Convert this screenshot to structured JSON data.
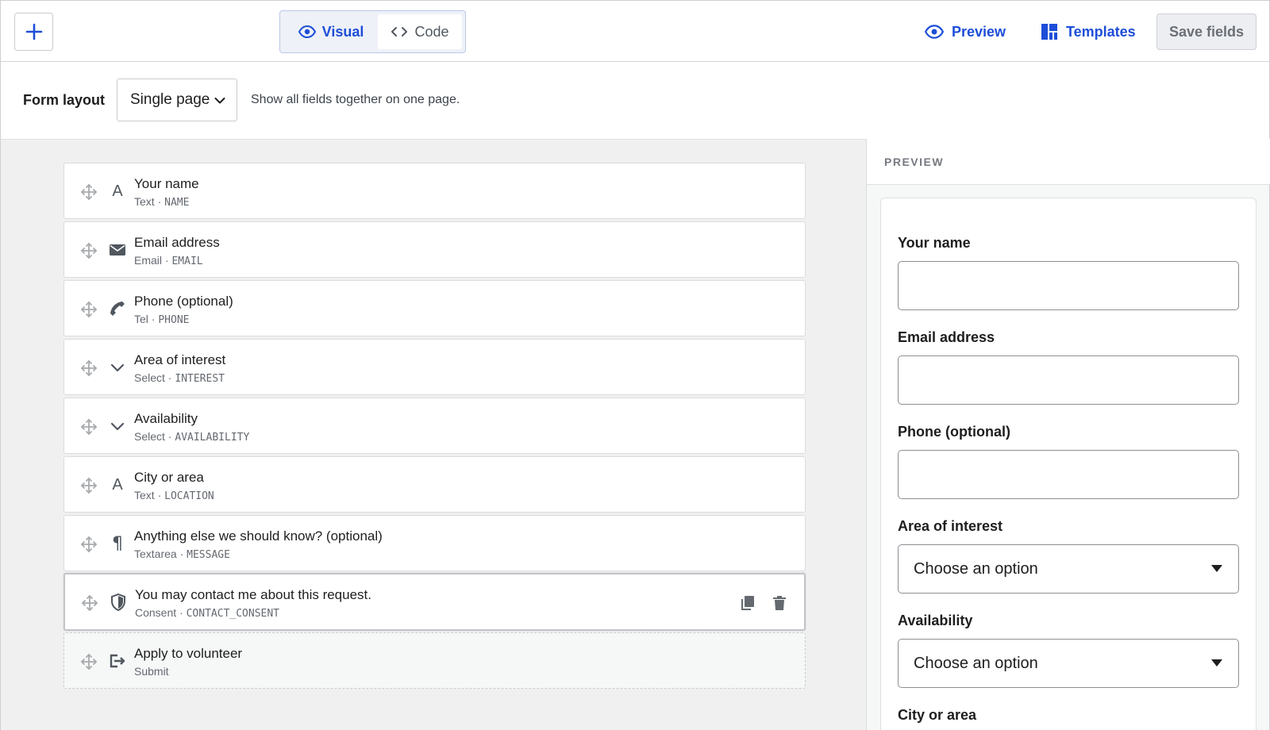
{
  "toolbar": {
    "add_icon": "plus-icon",
    "modes": [
      {
        "label": "Visual",
        "icon": "eye-icon",
        "active": true
      },
      {
        "label": "Code",
        "icon": "code-icon",
        "active": false
      }
    ],
    "preview_label": "Preview",
    "templates_label": "Templates",
    "save_label": "Save fields",
    "accent_color": "#1d4ed8"
  },
  "layout": {
    "label": "Form layout",
    "selected": "Single page",
    "help": "Show all fields together on one page."
  },
  "fields": [
    {
      "title": "Your name",
      "type": "Text",
      "key": "NAME",
      "icon": "text-a-icon"
    },
    {
      "title": "Email address",
      "type": "Email",
      "key": "EMAIL",
      "icon": "envelope-icon"
    },
    {
      "title": "Phone (optional)",
      "type": "Tel",
      "key": "PHONE",
      "icon": "phone-icon"
    },
    {
      "title": "Area of interest",
      "type": "Select",
      "key": "INTEREST",
      "icon": "chevron-down-icon"
    },
    {
      "title": "Availability",
      "type": "Select",
      "key": "AVAILABILITY",
      "icon": "chevron-down-icon"
    },
    {
      "title": "City or area",
      "type": "Text",
      "key": "LOCATION",
      "icon": "text-a-icon"
    },
    {
      "title": "Anything else we should know? (optional)",
      "type": "Textarea",
      "key": "MESSAGE",
      "icon": "pilcrow-icon"
    },
    {
      "title": "You may contact me about this request.",
      "type": "Consent",
      "key": "CONTACT_CONSENT",
      "icon": "shield-icon",
      "selected": true
    },
    {
      "title": "Apply to volunteer",
      "type": "Submit",
      "key": "",
      "icon": "submit-arrow-icon"
    }
  ],
  "field_separator": " · ",
  "preview": {
    "heading": "PREVIEW",
    "fields": [
      {
        "label": "Your name",
        "kind": "input"
      },
      {
        "label": "Email address",
        "kind": "input"
      },
      {
        "label": "Phone (optional)",
        "kind": "input"
      },
      {
        "label": "Area of interest",
        "kind": "select",
        "value": "Choose an option"
      },
      {
        "label": "Availability",
        "kind": "select",
        "value": "Choose an option"
      },
      {
        "label": "City or area",
        "kind": "input"
      }
    ]
  }
}
